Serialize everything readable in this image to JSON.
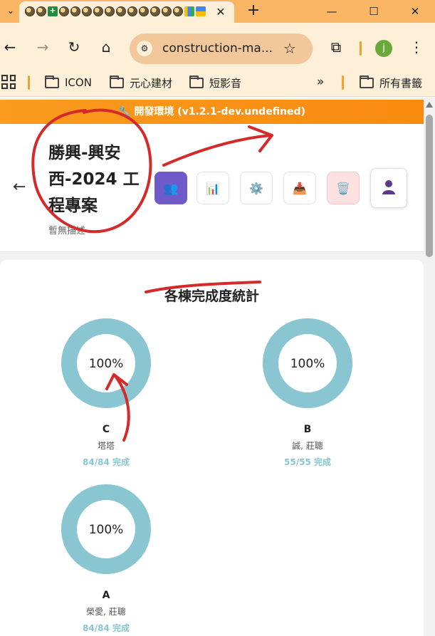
{
  "browser": {
    "tab_close": "✕",
    "new_tab": "+",
    "window_controls": {
      "minimize": "—",
      "maximize": "☐",
      "close": "✕"
    },
    "address": "construction-ma...",
    "bookmarks": [
      {
        "label": "ICON"
      },
      {
        "label": "元心建材"
      },
      {
        "label": "短影音"
      }
    ],
    "bookmarks_more": "»",
    "all_bookmarks": "所有書籤",
    "profile_initial": "j"
  },
  "env_banner": "🔧 開發環境 (v1.2.1-dev.undefined)",
  "project": {
    "back": "←",
    "title": "勝興-興安西-2024 工程專案",
    "description": "暫無描述"
  },
  "actions": [
    {
      "name": "team",
      "icon": "team-icon"
    },
    {
      "name": "chart",
      "icon": "bar-chart-icon"
    },
    {
      "name": "settings",
      "icon": "gear-icon"
    },
    {
      "name": "inbox",
      "icon": "inbox-icon"
    },
    {
      "name": "trash",
      "icon": "trash-icon"
    },
    {
      "name": "user",
      "icon": "user-icon"
    }
  ],
  "stats": {
    "title": "各棟完成度統計",
    "buildings": [
      {
        "name": "C",
        "people": "塔塔",
        "pct_label": "100%",
        "progress": "84/84 完成",
        "completion": 1.0
      },
      {
        "name": "B",
        "people": "誠, 莊聰",
        "pct_label": "100%",
        "progress": "55/55 完成",
        "completion": 1.0
      },
      {
        "name": "A",
        "people": "榮愛, 莊聰",
        "pct_label": "100%",
        "progress": "84/84 完成",
        "completion": 1.0
      }
    ]
  },
  "colors": {
    "tab_strip": "#fbb665",
    "toolbar": "#fdefd8",
    "banner": "#f98a10",
    "donut": "#8ac6d1",
    "annotation": "#d42a2a"
  }
}
